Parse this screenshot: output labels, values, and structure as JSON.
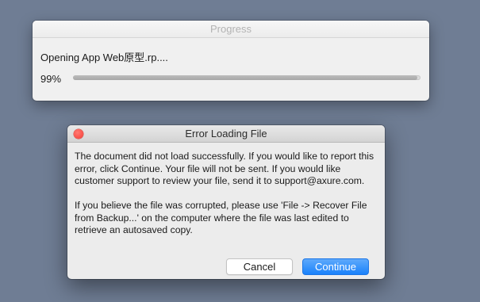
{
  "progress_window": {
    "title": "Progress",
    "message": "Opening App Web原型.rp....",
    "percent_label": "99%",
    "percent_value": 99
  },
  "error_dialog": {
    "title": "Error Loading File",
    "paragraph1": "The document did not load successfully. If you would like to report this error, click Continue. Your file will not be sent. If you would like customer support to review your file, send it to support@axure.com.",
    "paragraph2": "If you believe the file was corrupted, please use 'File -> Recover File from Backup...' on the computer where the file was last edited to retrieve an autosaved copy.",
    "cancel_label": "Cancel",
    "continue_label": "Continue"
  },
  "colors": {
    "desktop_background": "#6f7d94",
    "accent_button": "#1a82fb",
    "close_button": "#fc5750",
    "progress_fill": "#a7a7a7"
  },
  "icons": {
    "close": "close-icon"
  }
}
